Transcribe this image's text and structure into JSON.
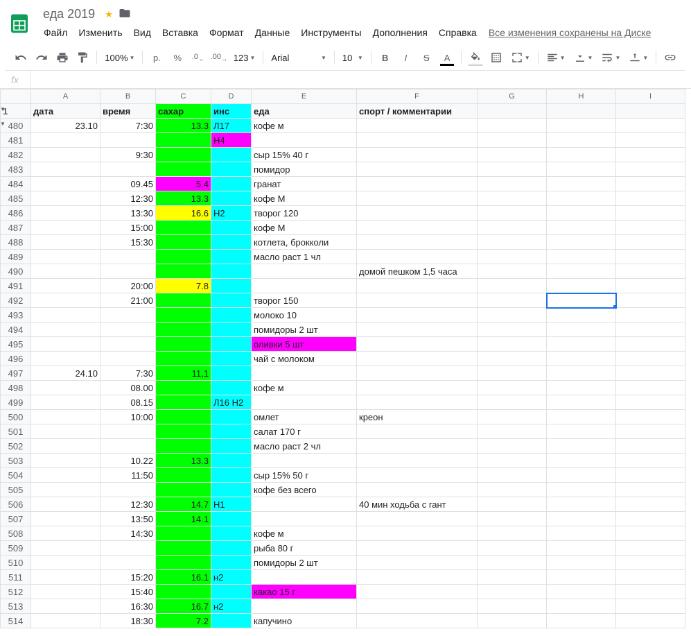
{
  "doc": {
    "title": "еда 2019",
    "save_status": "Все изменения сохранены на Диске"
  },
  "menubar": [
    "Файл",
    "Изменить",
    "Вид",
    "Вставка",
    "Формат",
    "Данные",
    "Инструменты",
    "Дополнения",
    "Справка"
  ],
  "toolbar": {
    "zoom": "100%",
    "currency": "р.",
    "percent": "%",
    "dec_dec": ".0",
    "dec_inc": ".00",
    "more_formats": "123",
    "font": "Arial",
    "font_size": "10"
  },
  "formula_bar": {
    "fx": "fx",
    "value": ""
  },
  "columns": [
    "A",
    "B",
    "C",
    "D",
    "E",
    "F",
    "G",
    "H",
    "I"
  ],
  "headers": {
    "A": "дата",
    "B": "время",
    "C": "сахар",
    "D": "инс",
    "E": "еда",
    "F": "спорт / комментарии",
    "G": "",
    "H": "",
    "I": ""
  },
  "header_row_num": "1",
  "rows": [
    {
      "n": "480",
      "A": "23.10",
      "B": "7:30",
      "C": "13.3",
      "Cbg": "green",
      "D": "Л17",
      "Dbg": "cyan",
      "E": "кофе м",
      "F": "",
      "arrow": true
    },
    {
      "n": "481",
      "A": "",
      "B": "",
      "C": "",
      "Cbg": "green",
      "D": "Н4",
      "Dbg": "magenta",
      "E": "",
      "F": ""
    },
    {
      "n": "482",
      "A": "",
      "B": "9:30",
      "C": "",
      "Cbg": "green",
      "D": "",
      "Dbg": "cyan",
      "E": "сыр 15% 40 г",
      "F": ""
    },
    {
      "n": "483",
      "A": "",
      "B": "",
      "C": "",
      "Cbg": "green",
      "D": "",
      "Dbg": "cyan",
      "E": "помидор",
      "F": ""
    },
    {
      "n": "484",
      "A": "",
      "B": "09.45",
      "C": "5.4",
      "Cbg": "magenta",
      "D": "",
      "Dbg": "cyan",
      "E": "гранат",
      "F": ""
    },
    {
      "n": "485",
      "A": "",
      "B": "12:30",
      "C": "13.3",
      "Cbg": "green",
      "D": "",
      "Dbg": "cyan",
      "E": "кофе М",
      "F": ""
    },
    {
      "n": "486",
      "A": "",
      "B": "13:30",
      "C": "16.6",
      "Cbg": "yellow",
      "D": "Н2",
      "Dbg": "cyan",
      "E": "творог 120",
      "F": ""
    },
    {
      "n": "487",
      "A": "",
      "B": "15:00",
      "C": "",
      "Cbg": "green",
      "D": "",
      "Dbg": "cyan",
      "E": "кофе М",
      "F": ""
    },
    {
      "n": "488",
      "A": "",
      "B": "15:30",
      "C": "",
      "Cbg": "green",
      "D": "",
      "Dbg": "cyan",
      "E": "котлета, брокколи",
      "F": ""
    },
    {
      "n": "489",
      "A": "",
      "B": "",
      "C": "",
      "Cbg": "green",
      "D": "",
      "Dbg": "cyan",
      "E": "масло раст 1 чл",
      "F": ""
    },
    {
      "n": "490",
      "A": "",
      "B": "",
      "C": "",
      "Cbg": "green",
      "D": "",
      "Dbg": "cyan",
      "E": "",
      "F": "домой пешком 1,5 часа"
    },
    {
      "n": "491",
      "A": "",
      "B": "20:00",
      "C": "7.8",
      "Cbg": "yellow",
      "D": "",
      "Dbg": "cyan",
      "E": "",
      "F": ""
    },
    {
      "n": "492",
      "A": "",
      "B": "21:00",
      "C": "",
      "Cbg": "green",
      "D": "",
      "Dbg": "cyan",
      "E": "творог 150",
      "F": "",
      "selected_H": true
    },
    {
      "n": "493",
      "A": "",
      "B": "",
      "C": "",
      "Cbg": "green",
      "D": "",
      "Dbg": "cyan",
      "E": "молоко 10",
      "F": ""
    },
    {
      "n": "494",
      "A": "",
      "B": "",
      "C": "",
      "Cbg": "green",
      "D": "",
      "Dbg": "cyan",
      "E": "помидоры 2 шт",
      "F": ""
    },
    {
      "n": "495",
      "A": "",
      "B": "",
      "C": "",
      "Cbg": "green",
      "D": "",
      "Dbg": "cyan",
      "E": "оливки 5 шт",
      "Ebg": "magenta",
      "F": ""
    },
    {
      "n": "496",
      "A": "",
      "B": "",
      "C": "",
      "Cbg": "green",
      "D": "",
      "Dbg": "cyan",
      "E": "чай с молоком",
      "F": ""
    },
    {
      "n": "497",
      "A": "24.10",
      "B": "7:30",
      "C": "11,1",
      "Cbg": "green",
      "D": "",
      "Dbg": "cyan",
      "E": "",
      "F": ""
    },
    {
      "n": "498",
      "A": "",
      "B": "08.00",
      "C": "",
      "Cbg": "green",
      "D": "",
      "Dbg": "cyan",
      "E": "кофе м",
      "F": ""
    },
    {
      "n": "499",
      "A": "",
      "B": "08.15",
      "C": "",
      "Cbg": "green",
      "D": "Л16 Н2",
      "Dbg": "cyan",
      "E": "",
      "F": ""
    },
    {
      "n": "500",
      "A": "",
      "B": "10:00",
      "C": "",
      "Cbg": "green",
      "D": "",
      "Dbg": "cyan",
      "E": "омлет",
      "F": "креон"
    },
    {
      "n": "501",
      "A": "",
      "B": "",
      "C": "",
      "Cbg": "green",
      "D": "",
      "Dbg": "cyan",
      "E": "салат 170 г",
      "F": ""
    },
    {
      "n": "502",
      "A": "",
      "B": "",
      "C": "",
      "Cbg": "green",
      "D": "",
      "Dbg": "cyan",
      "E": "масло раст 2 чл",
      "F": ""
    },
    {
      "n": "503",
      "A": "",
      "B": "10.22",
      "C": "13.3",
      "Cbg": "green",
      "D": "",
      "Dbg": "cyan",
      "E": "",
      "F": ""
    },
    {
      "n": "504",
      "A": "",
      "B": "11:50",
      "C": "",
      "Cbg": "green",
      "D": "",
      "Dbg": "cyan",
      "E": "сыр 15% 50 г",
      "F": ""
    },
    {
      "n": "505",
      "A": "",
      "B": "",
      "C": "",
      "Cbg": "green",
      "D": "",
      "Dbg": "cyan",
      "E": "кофе без всего",
      "F": ""
    },
    {
      "n": "506",
      "A": "",
      "B": "12:30",
      "C": "14.7",
      "Cbg": "green",
      "D": "Н1",
      "Dbg": "cyan",
      "E": "",
      "F": "40 мин ходьба с гант"
    },
    {
      "n": "507",
      "A": "",
      "B": "13:50",
      "C": "14.1",
      "Cbg": "green",
      "D": "",
      "Dbg": "cyan",
      "E": "",
      "F": ""
    },
    {
      "n": "508",
      "A": "",
      "B": "14:30",
      "C": "",
      "Cbg": "green",
      "D": "",
      "Dbg": "cyan",
      "E": "кофе м",
      "F": ""
    },
    {
      "n": "509",
      "A": "",
      "B": "",
      "C": "",
      "Cbg": "green",
      "D": "",
      "Dbg": "cyan",
      "E": "рыба 80 г",
      "F": ""
    },
    {
      "n": "510",
      "A": "",
      "B": "",
      "C": "",
      "Cbg": "green",
      "D": "",
      "Dbg": "cyan",
      "E": "помидоры 2 шт",
      "F": ""
    },
    {
      "n": "511",
      "A": "",
      "B": "15:20",
      "C": "16.1",
      "Cbg": "green",
      "D": "н2",
      "Dbg": "cyan",
      "E": "",
      "F": ""
    },
    {
      "n": "512",
      "A": "",
      "B": "15:40",
      "C": "",
      "Cbg": "green",
      "D": "",
      "Dbg": "cyan",
      "E": "какао 15 г",
      "Ebg": "magenta",
      "F": ""
    },
    {
      "n": "513",
      "A": "",
      "B": "16:30",
      "C": "16.7",
      "Cbg": "green",
      "D": "н2",
      "Dbg": "cyan",
      "E": "",
      "F": ""
    },
    {
      "n": "514",
      "A": "",
      "B": "18:30",
      "C": "7.2",
      "Cbg": "green",
      "D": "",
      "Dbg": "cyan",
      "E": "капучино",
      "F": ""
    }
  ]
}
